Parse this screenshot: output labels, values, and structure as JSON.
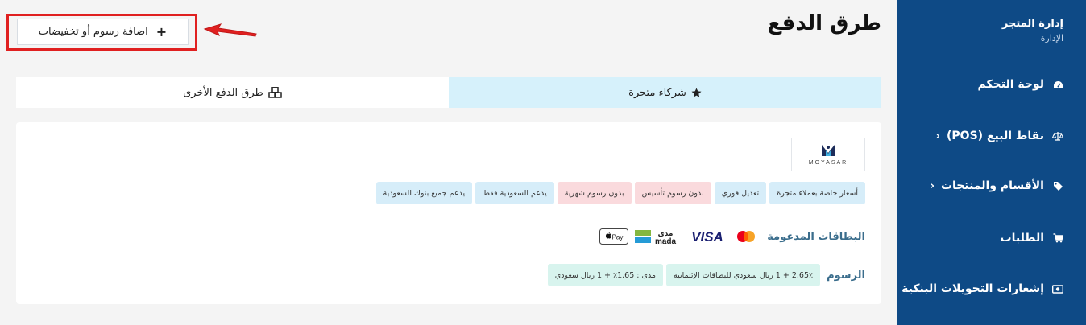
{
  "sidebar": {
    "title": "إدارة المتجر",
    "subtitle": "الإدارة",
    "items": [
      {
        "label": "لوحة التحكم",
        "icon": "dashboard-icon"
      },
      {
        "label": "نقاط البيع (POS)",
        "icon": "scale-icon",
        "has_submenu": true
      },
      {
        "label": "الأقسام والمنتجات",
        "icon": "tag-icon",
        "has_submenu": true
      },
      {
        "label": "الطلبات",
        "icon": "cart-icon"
      },
      {
        "label": "إشعارات التحويلات البنكية",
        "icon": "money-icon"
      }
    ],
    "chevron": "‹"
  },
  "page": {
    "title": "طرق الدفع"
  },
  "add_button": {
    "label": "اضافة رسوم أو تخفيضات",
    "plus": "+"
  },
  "tabs": [
    {
      "label": "شركاء متجرة",
      "icon": "star-icon",
      "active": true
    },
    {
      "label": "طرق الدفع الأخرى",
      "icon": "cubes-icon",
      "active": false
    }
  ],
  "provider": {
    "logo_text": "MOYASAR",
    "badges": [
      {
        "label": "أسعار خاصة بعملاء متجرة",
        "color": "blue"
      },
      {
        "label": "تعديل فوري",
        "color": "blue"
      },
      {
        "label": "بدون رسوم تأسيس",
        "color": "pink"
      },
      {
        "label": "بدون رسوم شهرية",
        "color": "pink"
      },
      {
        "label": "يدعم السعودية فقط",
        "color": "blue"
      },
      {
        "label": "يدعم جميع بنوك السعودية",
        "color": "blue"
      }
    ],
    "cards_label": "البطاقات المدعومة",
    "card_brands": {
      "mastercard": "mastercard",
      "visa": "VISA",
      "mada_ar": "مدى",
      "mada_en": "mada",
      "apple_pay": "Pay"
    },
    "fees_label": "الرسوم",
    "fees": [
      "2.65٪ + 1 ريال سعودي للبطاقات الإئتمانية",
      "مدى : 1.65٪ + 1 ريال سعودي"
    ]
  },
  "colors": {
    "sidebar": "#0e4a86",
    "accent_border": "#e02020",
    "tab_active": "#d6f1fb"
  }
}
